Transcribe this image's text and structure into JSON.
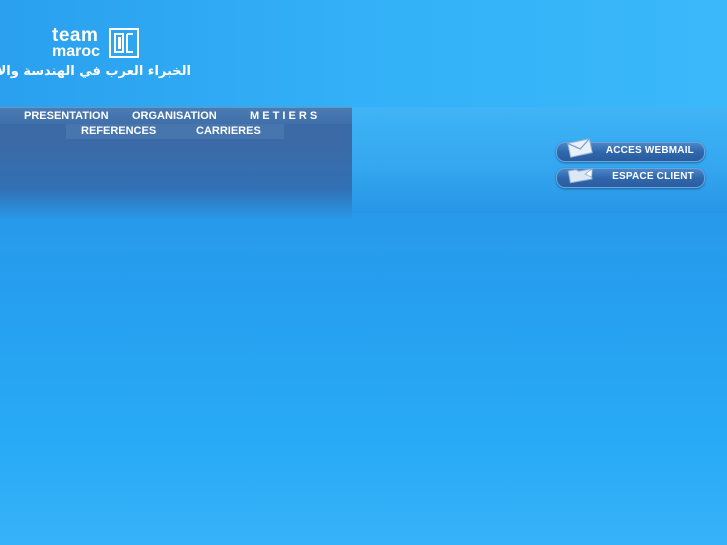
{
  "brand": {
    "logo_word1": "team",
    "logo_word2": "maroc",
    "arabic_tagline": "الخبراء العرب في الهندسة والادارة"
  },
  "nav": {
    "row1": [
      "PRESENTATION",
      "ORGANISATION",
      "M E T I E R S"
    ],
    "row2": [
      "REFERENCES",
      "CARRIERES"
    ]
  },
  "buttons": {
    "webmail": "ACCES WEBMAIL",
    "client": "ESPACE CLIENT"
  },
  "icons": {
    "logo_mark": "team-maroc-logo-icon",
    "webmail": "envelope-icon",
    "client": "folder-icon"
  },
  "colors": {
    "background_top": "#2c8ee0",
    "background_bottom": "#36b2f8",
    "nav_bar": "#3f6ea8",
    "pill": "#2f67ad",
    "text": "#ffffff"
  }
}
